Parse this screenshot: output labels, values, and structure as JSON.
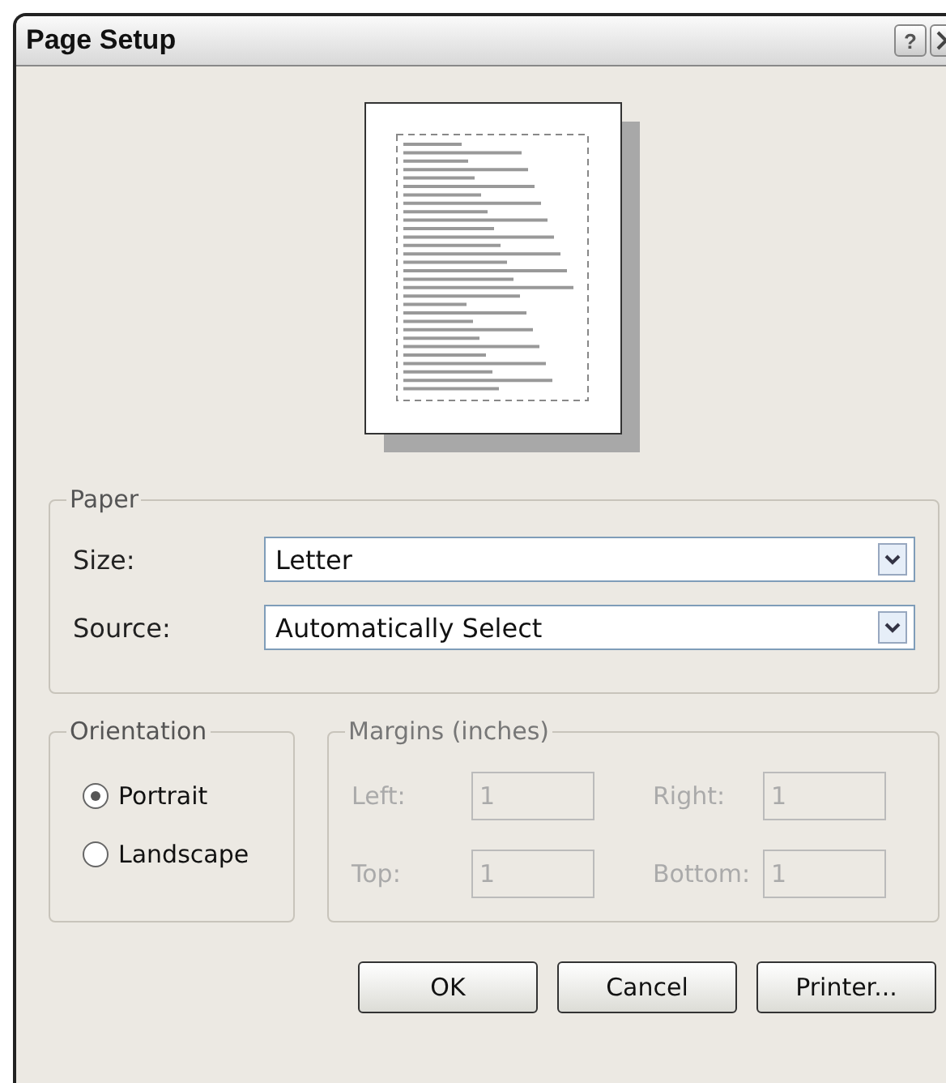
{
  "window": {
    "title": "Page Setup",
    "help_button": "?"
  },
  "paper": {
    "legend": "Paper",
    "fields": [
      {
        "label": "Size:",
        "value": "Letter"
      },
      {
        "label": "Source:",
        "value": "Automatically Select"
      }
    ]
  },
  "orientation": {
    "legend": "Orientation",
    "options": [
      {
        "label": "Portrait",
        "selected": true
      },
      {
        "label": "Landscape",
        "selected": false
      }
    ]
  },
  "margins": {
    "legend": "Margins (inches)",
    "disabled": true,
    "fields": [
      {
        "label": "Left:",
        "value": "1"
      },
      {
        "label": "Right:",
        "value": "1"
      },
      {
        "label": "Top:",
        "value": "1"
      },
      {
        "label": "Bottom:",
        "value": "1"
      }
    ]
  },
  "buttons": [
    "OK",
    "Cancel",
    "Printer..."
  ]
}
